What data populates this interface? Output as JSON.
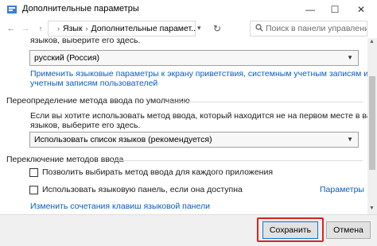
{
  "window": {
    "title": "Дополнительные параметры",
    "min_glyph": "—",
    "max_glyph": "☐",
    "close_glyph": "✕"
  },
  "addressbar": {
    "back_glyph": "←",
    "forward_glyph": "→",
    "up_glyph": "↑",
    "breadcrumb": [
      "Язык",
      "Дополнительные парамет..."
    ],
    "separator": "›",
    "dropdown_glyph": "▾",
    "refresh_glyph": "↻",
    "search_placeholder": "Поиск в панели управления"
  },
  "content": {
    "top_text": "языков, выберите его здесь.",
    "language_select": "русский (Россия)",
    "apply_link_line1": "Применить языковые параметры к экрану приветствия, системным учетным записям и новым",
    "apply_link_line2": "учетным записям пользователей",
    "override_section_title": "Переопределение метода ввода по умолчанию",
    "override_desc_line1": "Если вы хотите использовать метод ввода, который находится не на первом месте в вашем списке",
    "override_desc_line2": "языков, выберите его здесь.",
    "input_method_select": "Использовать список языков (рекомендуется)",
    "switch_section_title": "Переключение методов ввода",
    "checkbox_per_app": "Позволить выбирать метод ввода для каждого приложения",
    "checkbox_language_bar": "Использовать языковую панель, если она доступна",
    "parameters_link": "Параметры",
    "change_hotkeys_link": "Изменить сочетания клавиш языковой панели"
  },
  "footer": {
    "save_label": "Сохранить",
    "cancel_label": "Отмена"
  },
  "colors": {
    "link": "#0a5cc2",
    "highlight": "#e02020",
    "footer_bg": "#f0f0f0"
  }
}
